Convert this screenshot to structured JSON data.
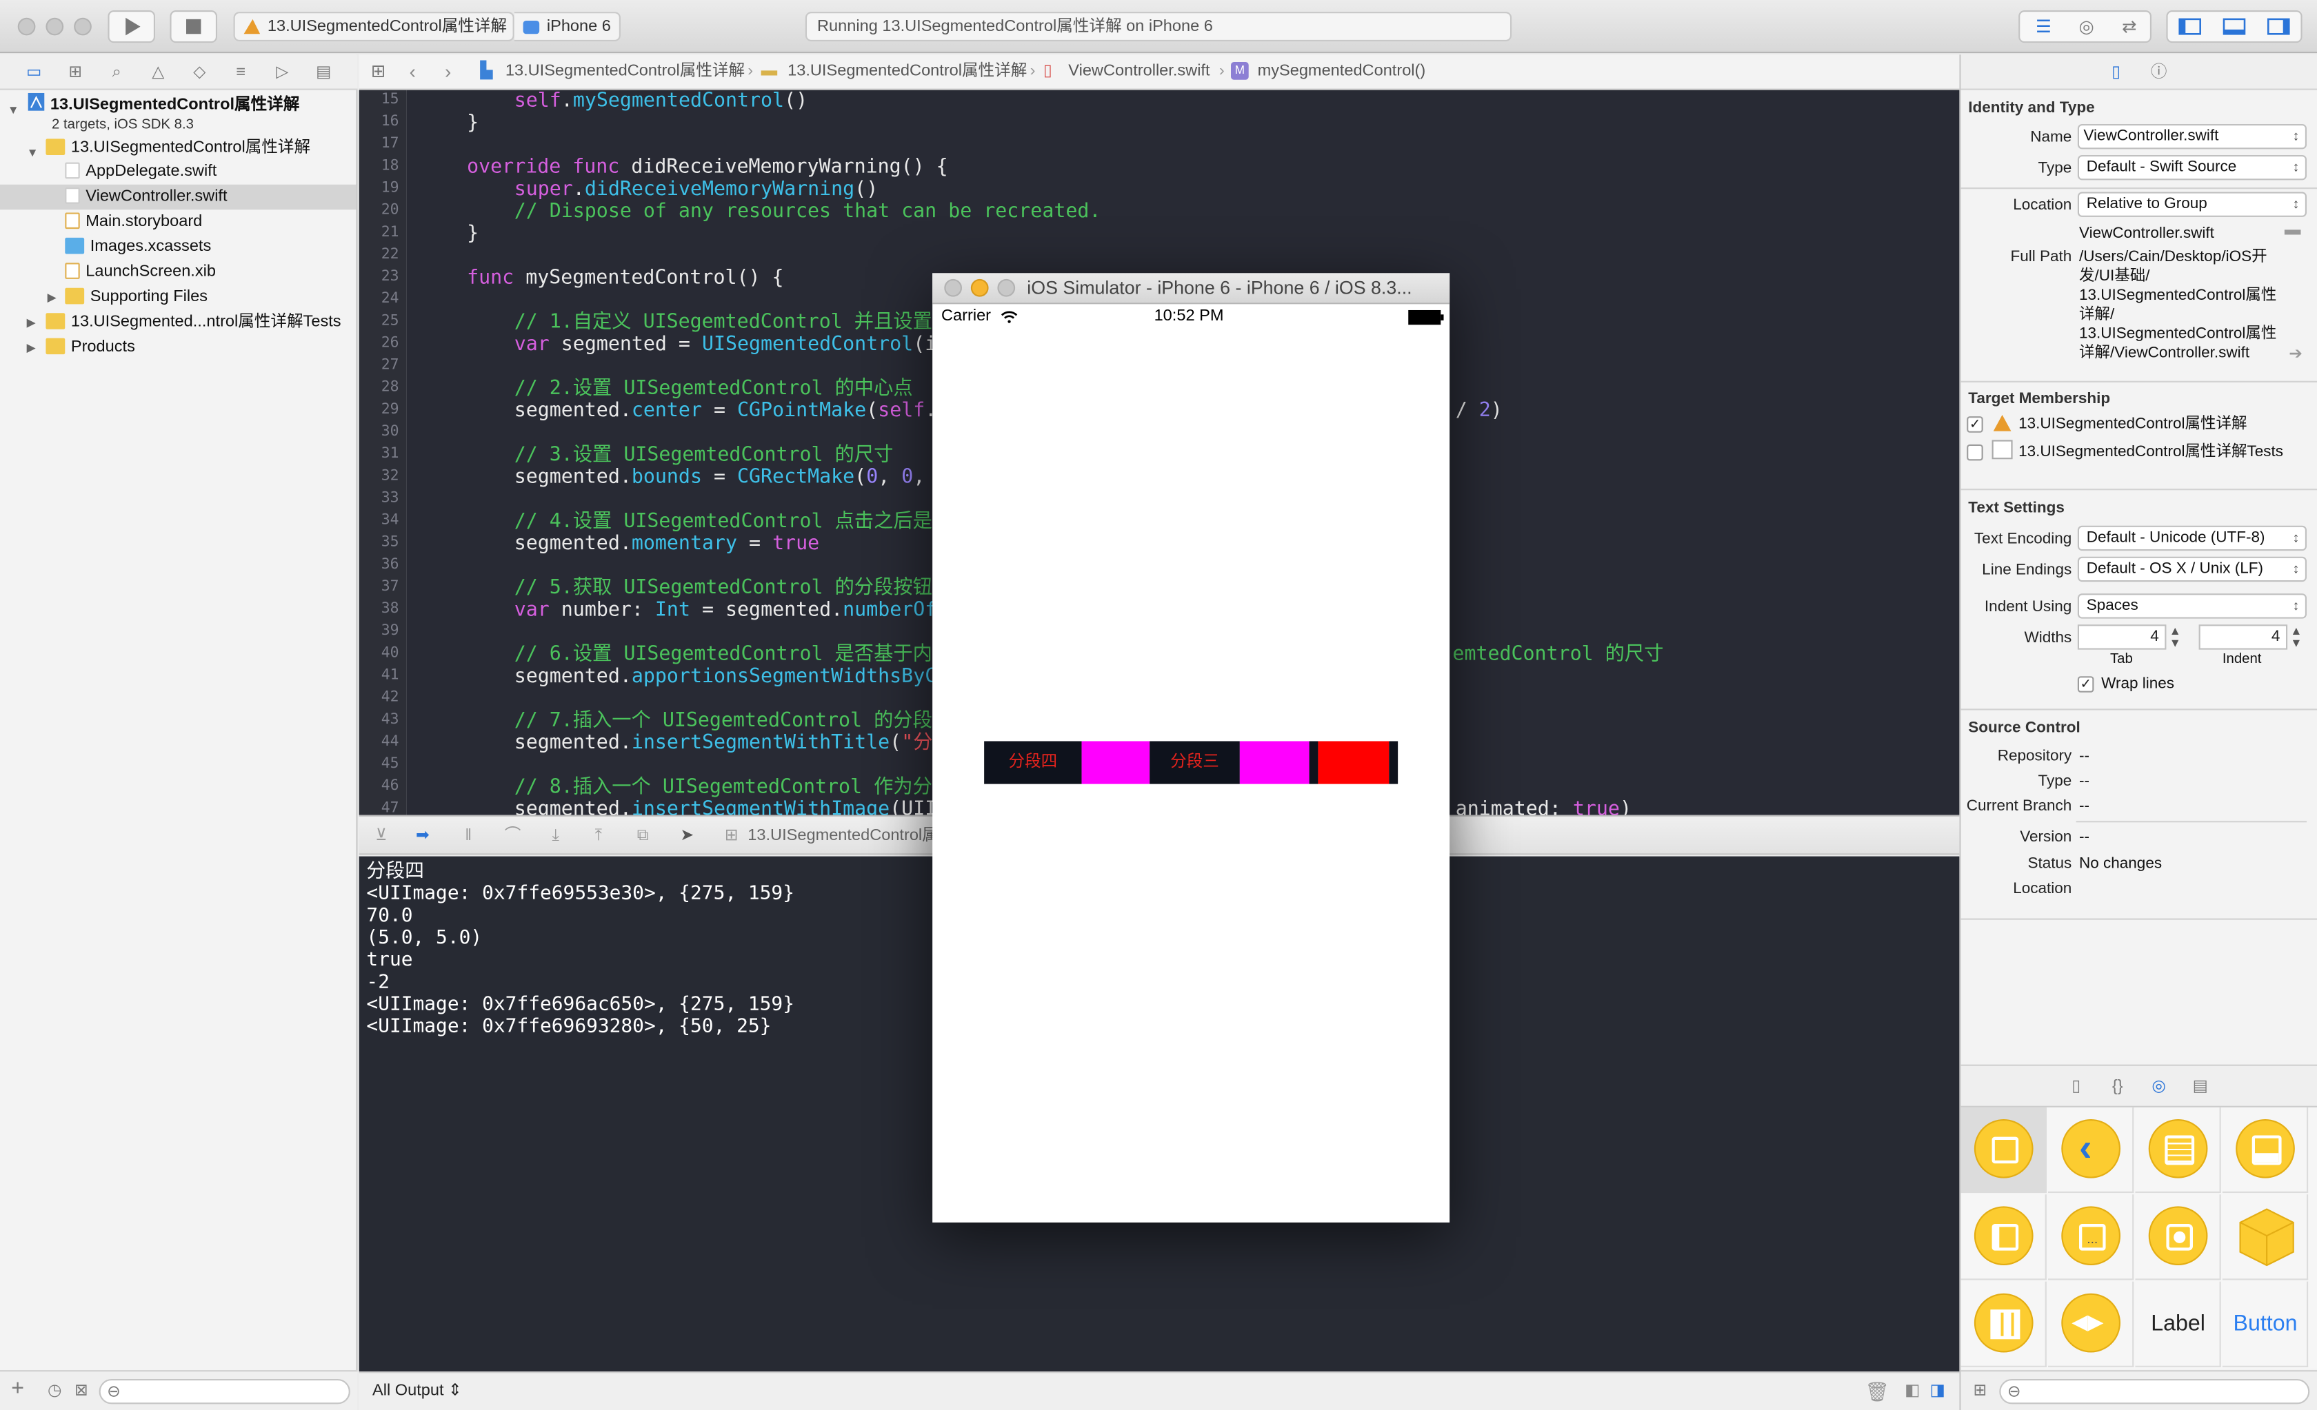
{
  "toolbar": {
    "scheme": "13.UISegmentedControl属性详解",
    "device": "iPhone 6",
    "activity": "Running 13.UISegmentedControl属性详解 on iPhone 6"
  },
  "navigator": {
    "project": "13.UISegmentedControl属性详解",
    "project_sub": "2 targets, iOS SDK 8.3",
    "group": "13.UISegmentedControl属性详解",
    "files": [
      "AppDelegate.swift",
      "ViewController.swift",
      "Main.storyboard",
      "Images.xcassets",
      "LaunchScreen.xib",
      "Supporting Files"
    ],
    "tests": "13.UISegmented...ntrol属性详解Tests",
    "products": "Products"
  },
  "jumpbar": {
    "crumbs": [
      "13.UISegmentedControl属性详解",
      "13.UISegmentedControl属性详解",
      "ViewController.swift",
      "mySegmentedControl()"
    ]
  },
  "editor": {
    "line_numbers": [
      "15",
      "16",
      "17",
      "18",
      "19",
      "20",
      "21",
      "22",
      "23",
      "24",
      "25",
      "26",
      "27",
      "28",
      "29",
      "30",
      "31",
      "32",
      "33",
      "34",
      "35",
      "36",
      "37",
      "38",
      "39",
      "40",
      "41",
      "42",
      "43",
      "44",
      "45",
      "46",
      "47"
    ]
  },
  "debug": {
    "breadcrumb": "13.UISegmentedControl属",
    "console": [
      "分段四",
      "<UIImage: 0x7ffe69553e30>, {275, 159}",
      "70.0",
      "(5.0, 5.0)",
      "true",
      "-2",
      "<UIImage: 0x7ffe696ac650>, {275, 159}",
      "<UIImage: 0x7ffe69693280>, {50, 25}"
    ],
    "output_filter": "All Output ⇕"
  },
  "simulator": {
    "title": "iOS Simulator - iPhone 6 - iPhone 6 / iOS 8.3...",
    "carrier": "Carrier",
    "time": "10:52 PM",
    "segments": [
      {
        "label": "分段四",
        "color": "#0e121c"
      },
      {
        "label": "",
        "color": "#ff00ff"
      },
      {
        "label": "分段三",
        "color": "#0e121c"
      },
      {
        "label": "",
        "color": "#ff00ff"
      },
      {
        "label": "",
        "color": "#0e121c"
      },
      {
        "label": "",
        "color": "#ff0000"
      },
      {
        "label": "",
        "color": "#0e121c"
      }
    ]
  },
  "inspector": {
    "identity_title": "Identity and Type",
    "name_label": "Name",
    "name_value": "ViewController.swift",
    "type_label": "Type",
    "type_value": "Default - Swift Source",
    "location_label": "Location",
    "location_value": "Relative to Group",
    "location_file": "ViewController.swift",
    "fullpath_label": "Full Path",
    "fullpath_lines": [
      "/Users/Cain/Desktop/iOS开",
      "发/UI基础/",
      "13.UISegmentedControl属性",
      "详解/",
      "13.UISegmentedControl属性",
      "详解/ViewController.swift"
    ],
    "target_title": "Target Membership",
    "targets": [
      "13.UISegmentedControl属性详解",
      "13.UISegmentedControl属性详解Tests"
    ],
    "text_title": "Text Settings",
    "encoding_label": "Text Encoding",
    "encoding_value": "Default - Unicode (UTF-8)",
    "endings_label": "Line Endings",
    "endings_value": "Default - OS X / Unix (LF)",
    "indent_label": "Indent Using",
    "indent_value": "Spaces",
    "widths_label": "Widths",
    "tab_value": "4",
    "indent_width_value": "4",
    "tab_label": "Tab",
    "indent_sub_label": "Indent",
    "wrap_label": "Wrap lines",
    "source_title": "Source Control",
    "repository_label": "Repository",
    "repository_value": "--",
    "sc_type_label": "Type",
    "sc_type_value": "--",
    "branch_label": "Current Branch",
    "branch_value": "--",
    "version_label": "Version",
    "version_value": "--",
    "status_label": "Status",
    "status_value": "No changes",
    "sc_location_label": "Location",
    "library": {
      "label_item": "Label",
      "button_item": "Button"
    }
  }
}
